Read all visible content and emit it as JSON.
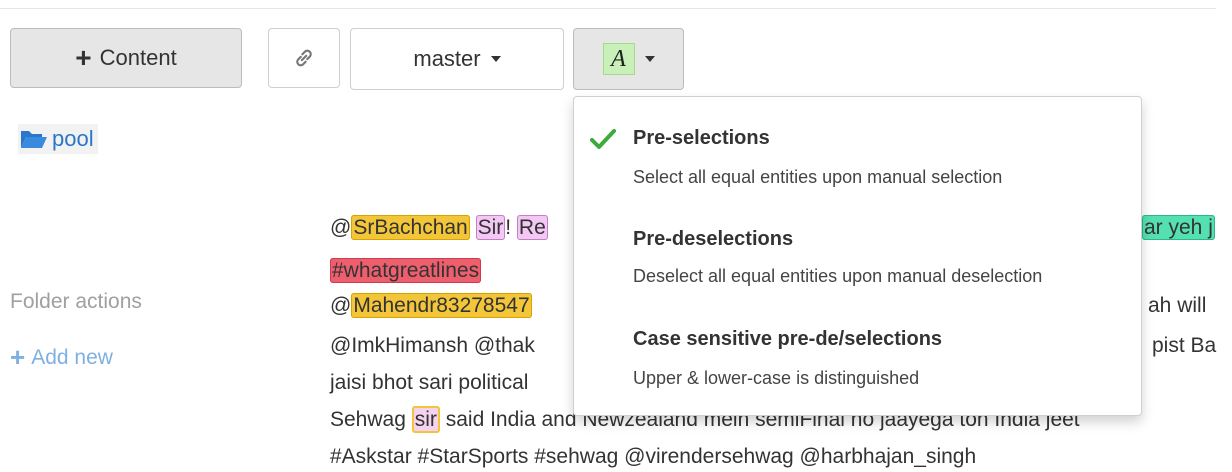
{
  "toolbar": {
    "content_label": "Content",
    "branch_label": "master",
    "annotation_letter": "A"
  },
  "sidebar": {
    "folder_label": "pool",
    "folder_actions_label": "Folder actions",
    "add_new_label": "Add new"
  },
  "document": {
    "line1": {
      "pre": "@",
      "mention": "SrBachchan",
      "space1": " ",
      "sir": "Sir",
      "bang": "! ",
      "re": "Re",
      "tail": "ar yeh j"
    },
    "line2": {
      "hashtag": "#whatgreatlines"
    },
    "line3": {
      "pre": "@",
      "mention": "Mahendr83278547",
      "tail": "ah will"
    },
    "line4": {
      "head": "@ImkHimansh @thak",
      "tail": "pist Ba"
    },
    "line5": {
      "head": "jaisi bhot sari political"
    },
    "line6": {
      "head": "Sehwag ",
      "sir": "sir",
      "tail": " said India and Newzealand mein semiFinal no jaayega ton India jeet"
    },
    "line7": {
      "head": "#Askstar #StarSports #sehwag @virendersehwag @harbhajan_singh"
    }
  },
  "annotation_menu": {
    "items": [
      {
        "title": "Pre-selections",
        "description": "Select all equal entities upon manual selection",
        "checked": true
      },
      {
        "title": "Pre-deselections",
        "description": "Deselect all equal entities upon manual deselection",
        "checked": false
      },
      {
        "title": "Case sensitive pre-de/selections",
        "description": "Upper & lower-case is distinguished",
        "checked": false
      }
    ]
  },
  "colors": {
    "check_green": "#3cab3c",
    "link_blue": "#2a77c9",
    "highlight_yellow": "#f3c63a",
    "highlight_pink": "#f4c8f4",
    "highlight_red": "#ee5f6e",
    "highlight_green": "#55e0b2",
    "annotation_icon_bg": "#c8f0b8"
  },
  "icons": [
    "plus-icon",
    "link-icon",
    "caret-down-icon",
    "folder-open-icon",
    "checkmark-icon"
  ]
}
